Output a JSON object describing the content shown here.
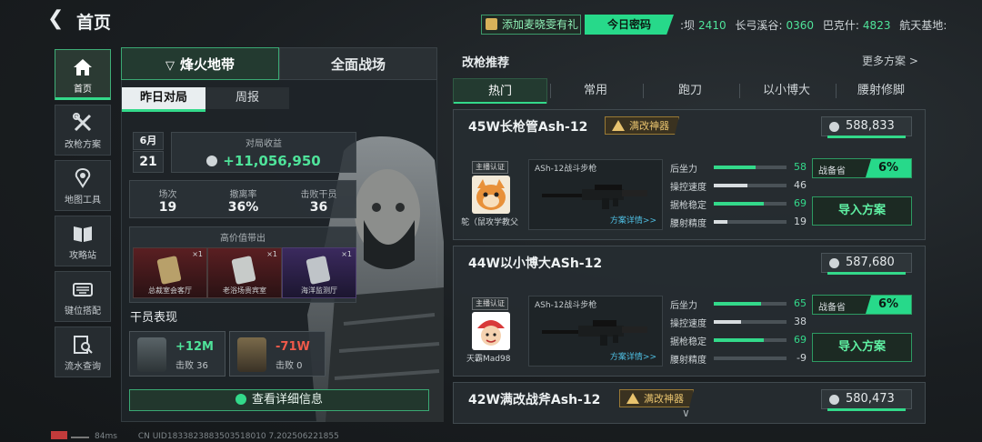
{
  "header": {
    "back_icon": "back-arrow-icon",
    "title": "首页",
    "gift_label": "添加麦晓雯有礼",
    "daily_code_label": "今日密码",
    "ticker": [
      {
        "name": ":坝",
        "value": "2410"
      },
      {
        "name": "长弓溪谷",
        "value": "0360"
      },
      {
        "name": "巴克什",
        "value": "4823"
      },
      {
        "name": "航天基地",
        "value": ""
      }
    ]
  },
  "sidebar": {
    "items": [
      {
        "label": "首页",
        "icon": "home-icon",
        "active": true
      },
      {
        "label": "改枪方案",
        "icon": "wrench-gun-icon",
        "active": false
      },
      {
        "label": "地图工具",
        "icon": "map-pin-icon",
        "active": false
      },
      {
        "label": "攻略站",
        "icon": "book-icon",
        "active": false
      },
      {
        "label": "键位搭配",
        "icon": "keyboard-icon",
        "active": false
      },
      {
        "label": "流水查询",
        "icon": "search-record-icon",
        "active": false
      }
    ]
  },
  "mode_tabs": [
    "烽火地带",
    "全面战场"
  ],
  "sub_tabs": [
    "昨日对局",
    "周报"
  ],
  "summary": {
    "month": "6月",
    "day": "21",
    "income_label": "对局收益",
    "income_value": "+11,056,950",
    "stats": [
      {
        "label": "场次",
        "value": "19"
      },
      {
        "label": "撤离率",
        "value": "36%"
      },
      {
        "label": "击败干员",
        "value": "36"
      }
    ],
    "high_value_title": "高价值带出",
    "items": [
      {
        "name": "总裁室会客厅",
        "count": "×1",
        "color": "#b8a06a"
      },
      {
        "name": "老浴场贵宾室",
        "count": "×1",
        "color": "#c7cbc9"
      },
      {
        "name": "海洋监测厅",
        "count": "×1",
        "color": "#bfc4c8"
      }
    ],
    "operator_title": "干员表现",
    "operators": [
      {
        "amount": "+12M",
        "kills": "击败 36",
        "color": "#4fe39a"
      },
      {
        "amount": "-71W",
        "kills": "击败 0",
        "color": "#f05a4a"
      }
    ],
    "detail_button": "查看详细信息"
  },
  "recommend": {
    "title": "改枪推荐",
    "more": "更多方案 >",
    "categories": [
      "热门",
      "常用",
      "跑刀",
      "以小博大",
      "腰射修脚"
    ],
    "cards": [
      {
        "title": "45W长枪管Ash-12",
        "badge": "满改神器",
        "price": "588,833",
        "anchor_label": "主播认证",
        "anchor_name": "鸵（鼠攻学教父",
        "gun_name": "ASh-12战斗步枪",
        "gun_detail": "方案详情>>",
        "attrs": [
          {
            "name": "后坐力",
            "value": "58",
            "pct": 0.58,
            "color": "#33d98a"
          },
          {
            "name": "操控速度",
            "value": "46",
            "pct": 0.46,
            "color": "#d8dde0"
          },
          {
            "name": "据枪稳定",
            "value": "69",
            "pct": 0.69,
            "color": "#33d98a"
          },
          {
            "name": "腰射精度",
            "value": "19",
            "pct": 0.19,
            "color": "#d8dde0"
          }
        ],
        "combat_label": "战备省",
        "combat_value": "6%",
        "import_label": "导入方案"
      },
      {
        "title": "44W以小博大ASh-12",
        "badge": "",
        "price": "587,680",
        "anchor_label": "主播认证",
        "anchor_name": "天霸Mad98",
        "gun_name": "ASh-12战斗步枪",
        "gun_detail": "方案详情>>",
        "attrs": [
          {
            "name": "后坐力",
            "value": "65",
            "pct": 0.65,
            "color": "#33d98a"
          },
          {
            "name": "操控速度",
            "value": "38",
            "pct": 0.38,
            "color": "#d8dde0"
          },
          {
            "name": "据枪稳定",
            "value": "69",
            "pct": 0.69,
            "color": "#33d98a"
          },
          {
            "name": "腰射精度",
            "value": "-9",
            "pct": 0.0,
            "color": "#d8dde0"
          }
        ],
        "combat_label": "战备省",
        "combat_value": "6%",
        "import_label": "导入方案"
      },
      {
        "title": "42W满改战斧Ash-12",
        "badge": "满改神器",
        "price": "580,473"
      }
    ]
  },
  "status_bar": {
    "ping": "84ms",
    "uid": "CN UID1833823883503518010 7.202506221855"
  }
}
